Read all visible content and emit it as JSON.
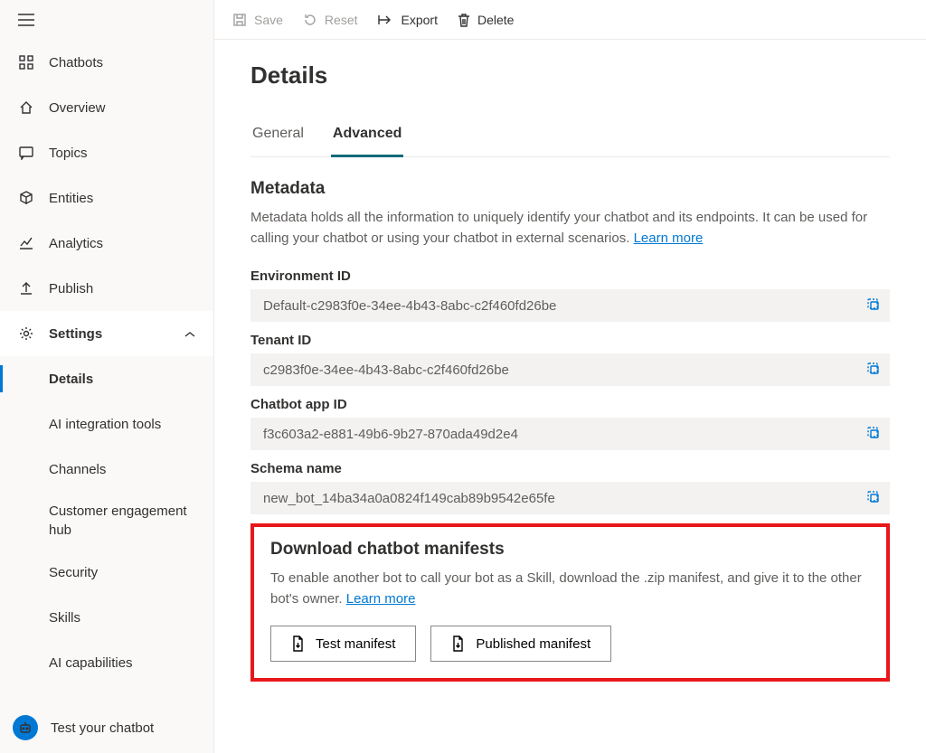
{
  "sidebar": {
    "items": [
      {
        "label": "Chatbots",
        "name": "sidebar-item-chatbots"
      },
      {
        "label": "Overview",
        "name": "sidebar-item-overview"
      },
      {
        "label": "Topics",
        "name": "sidebar-item-topics"
      },
      {
        "label": "Entities",
        "name": "sidebar-item-entities"
      },
      {
        "label": "Analytics",
        "name": "sidebar-item-analytics"
      },
      {
        "label": "Publish",
        "name": "sidebar-item-publish"
      },
      {
        "label": "Settings",
        "name": "sidebar-item-settings"
      }
    ],
    "subitems": [
      {
        "label": "Details",
        "name": "sidebar-sub-details"
      },
      {
        "label": "AI integration tools",
        "name": "sidebar-sub-ai-integration"
      },
      {
        "label": "Channels",
        "name": "sidebar-sub-channels"
      },
      {
        "label": "Customer engagement hub",
        "name": "sidebar-sub-customer-engagement"
      },
      {
        "label": "Security",
        "name": "sidebar-sub-security"
      },
      {
        "label": "Skills",
        "name": "sidebar-sub-skills"
      },
      {
        "label": "AI capabilities",
        "name": "sidebar-sub-ai-capabilities"
      }
    ],
    "footer_label": "Test your chatbot"
  },
  "toolbar": {
    "save": "Save",
    "reset": "Reset",
    "export": "Export",
    "delete": "Delete"
  },
  "page": {
    "title": "Details",
    "tabs": {
      "general": "General",
      "advanced": "Advanced"
    },
    "metadata": {
      "heading": "Metadata",
      "desc": "Metadata holds all the information to uniquely identify your chatbot and its endpoints. It can be used for calling your chatbot or using your chatbot in external scenarios. ",
      "learn": "Learn more"
    },
    "fields": {
      "env_label": "Environment ID",
      "env_value": "Default-c2983f0e-34ee-4b43-8abc-c2f460fd26be",
      "tenant_label": "Tenant ID",
      "tenant_value": "c2983f0e-34ee-4b43-8abc-c2f460fd26be",
      "appid_label": "Chatbot app ID",
      "appid_value": "f3c603a2-e881-49b6-9b27-870ada49d2e4",
      "schema_label": "Schema name",
      "schema_value": "new_bot_14ba34a0a0824f149cab89b9542e65fe"
    },
    "manifests": {
      "heading": "Download chatbot manifests",
      "desc": "To enable another bot to call your bot as a Skill, download the .zip manifest, and give it to the other bot's owner. ",
      "learn": "Learn more",
      "test_btn": "Test manifest",
      "pub_btn": "Published manifest"
    }
  }
}
